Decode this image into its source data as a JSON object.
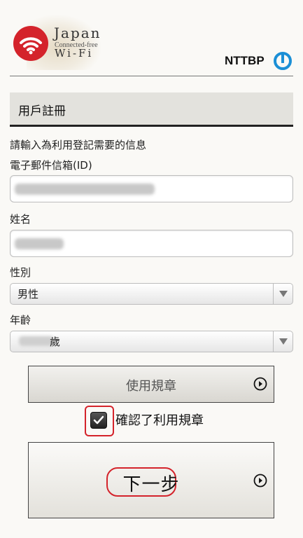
{
  "brand": {
    "logo_line1": "Japan",
    "logo_line2": "Connected-free",
    "logo_line3": "Wi-Fi",
    "partner": "NTTBP",
    "accent_red": "#d4232b",
    "partner_blue": "#1b8fd6"
  },
  "form": {
    "section_title": "用戶註冊",
    "instruction": "請輸入為利用登記需要的信息",
    "email_label": "電子郵件信箱(ID)",
    "email_value": "",
    "name_label": "姓名",
    "name_value": "",
    "gender_label": "性別",
    "gender_value": "男性",
    "age_label": "年齡",
    "age_suffix": "歲"
  },
  "actions": {
    "terms_button": "使用規章",
    "agree_checkbox_checked": true,
    "agree_label": "確認了利用規章",
    "next_button": "下一步"
  },
  "icons": {
    "wifi_logo": "wifi-logo-icon",
    "nttbp_logo": "nttbp-ring-icon",
    "dropdown": "dropdown-triangle-icon",
    "forward": "circled-play-icon",
    "check": "check-icon"
  }
}
